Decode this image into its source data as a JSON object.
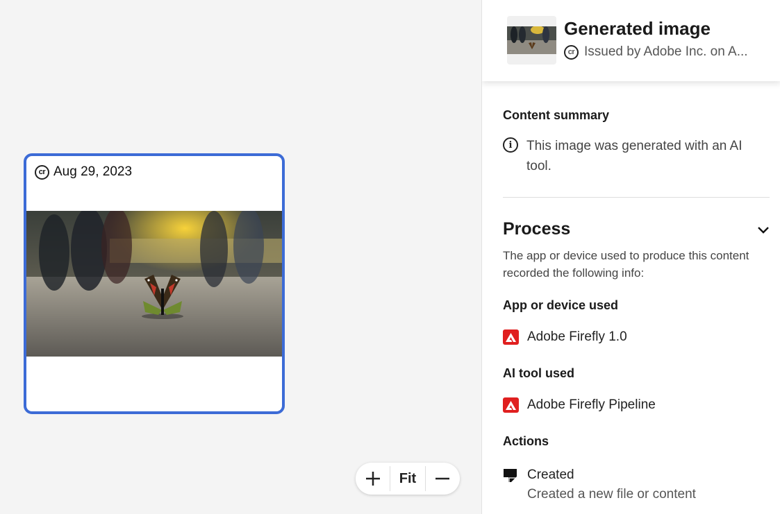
{
  "canvas": {
    "card": {
      "date_label": "Aug 29, 2023",
      "image_alt": "Butterfly on a city street",
      "cr_badge": "cr"
    },
    "zoom": {
      "zoom_in_icon": "plus-icon",
      "fit_label": "Fit",
      "zoom_out_icon": "minus-icon"
    }
  },
  "panel": {
    "header": {
      "title": "Generated image",
      "issued_by": "Issued by Adobe Inc. on A...",
      "cr_badge": "cr"
    },
    "content_summary": {
      "label": "Content summary",
      "text": "This image was generated with an AI tool.",
      "icon": "info-icon"
    },
    "process": {
      "title": "Process",
      "description": "The app or device used to produce this content recorded the following info:",
      "app_label": "App or device used",
      "app_value": "Adobe Firefly 1.0",
      "ai_label": "AI tool used",
      "ai_value": "Adobe Firefly Pipeline",
      "actions_label": "Actions",
      "action_title": "Created",
      "action_desc": "Created a new file or content"
    }
  },
  "colors": {
    "accent_border": "#3c6bd6",
    "adobe_red": "#e01f1f"
  }
}
